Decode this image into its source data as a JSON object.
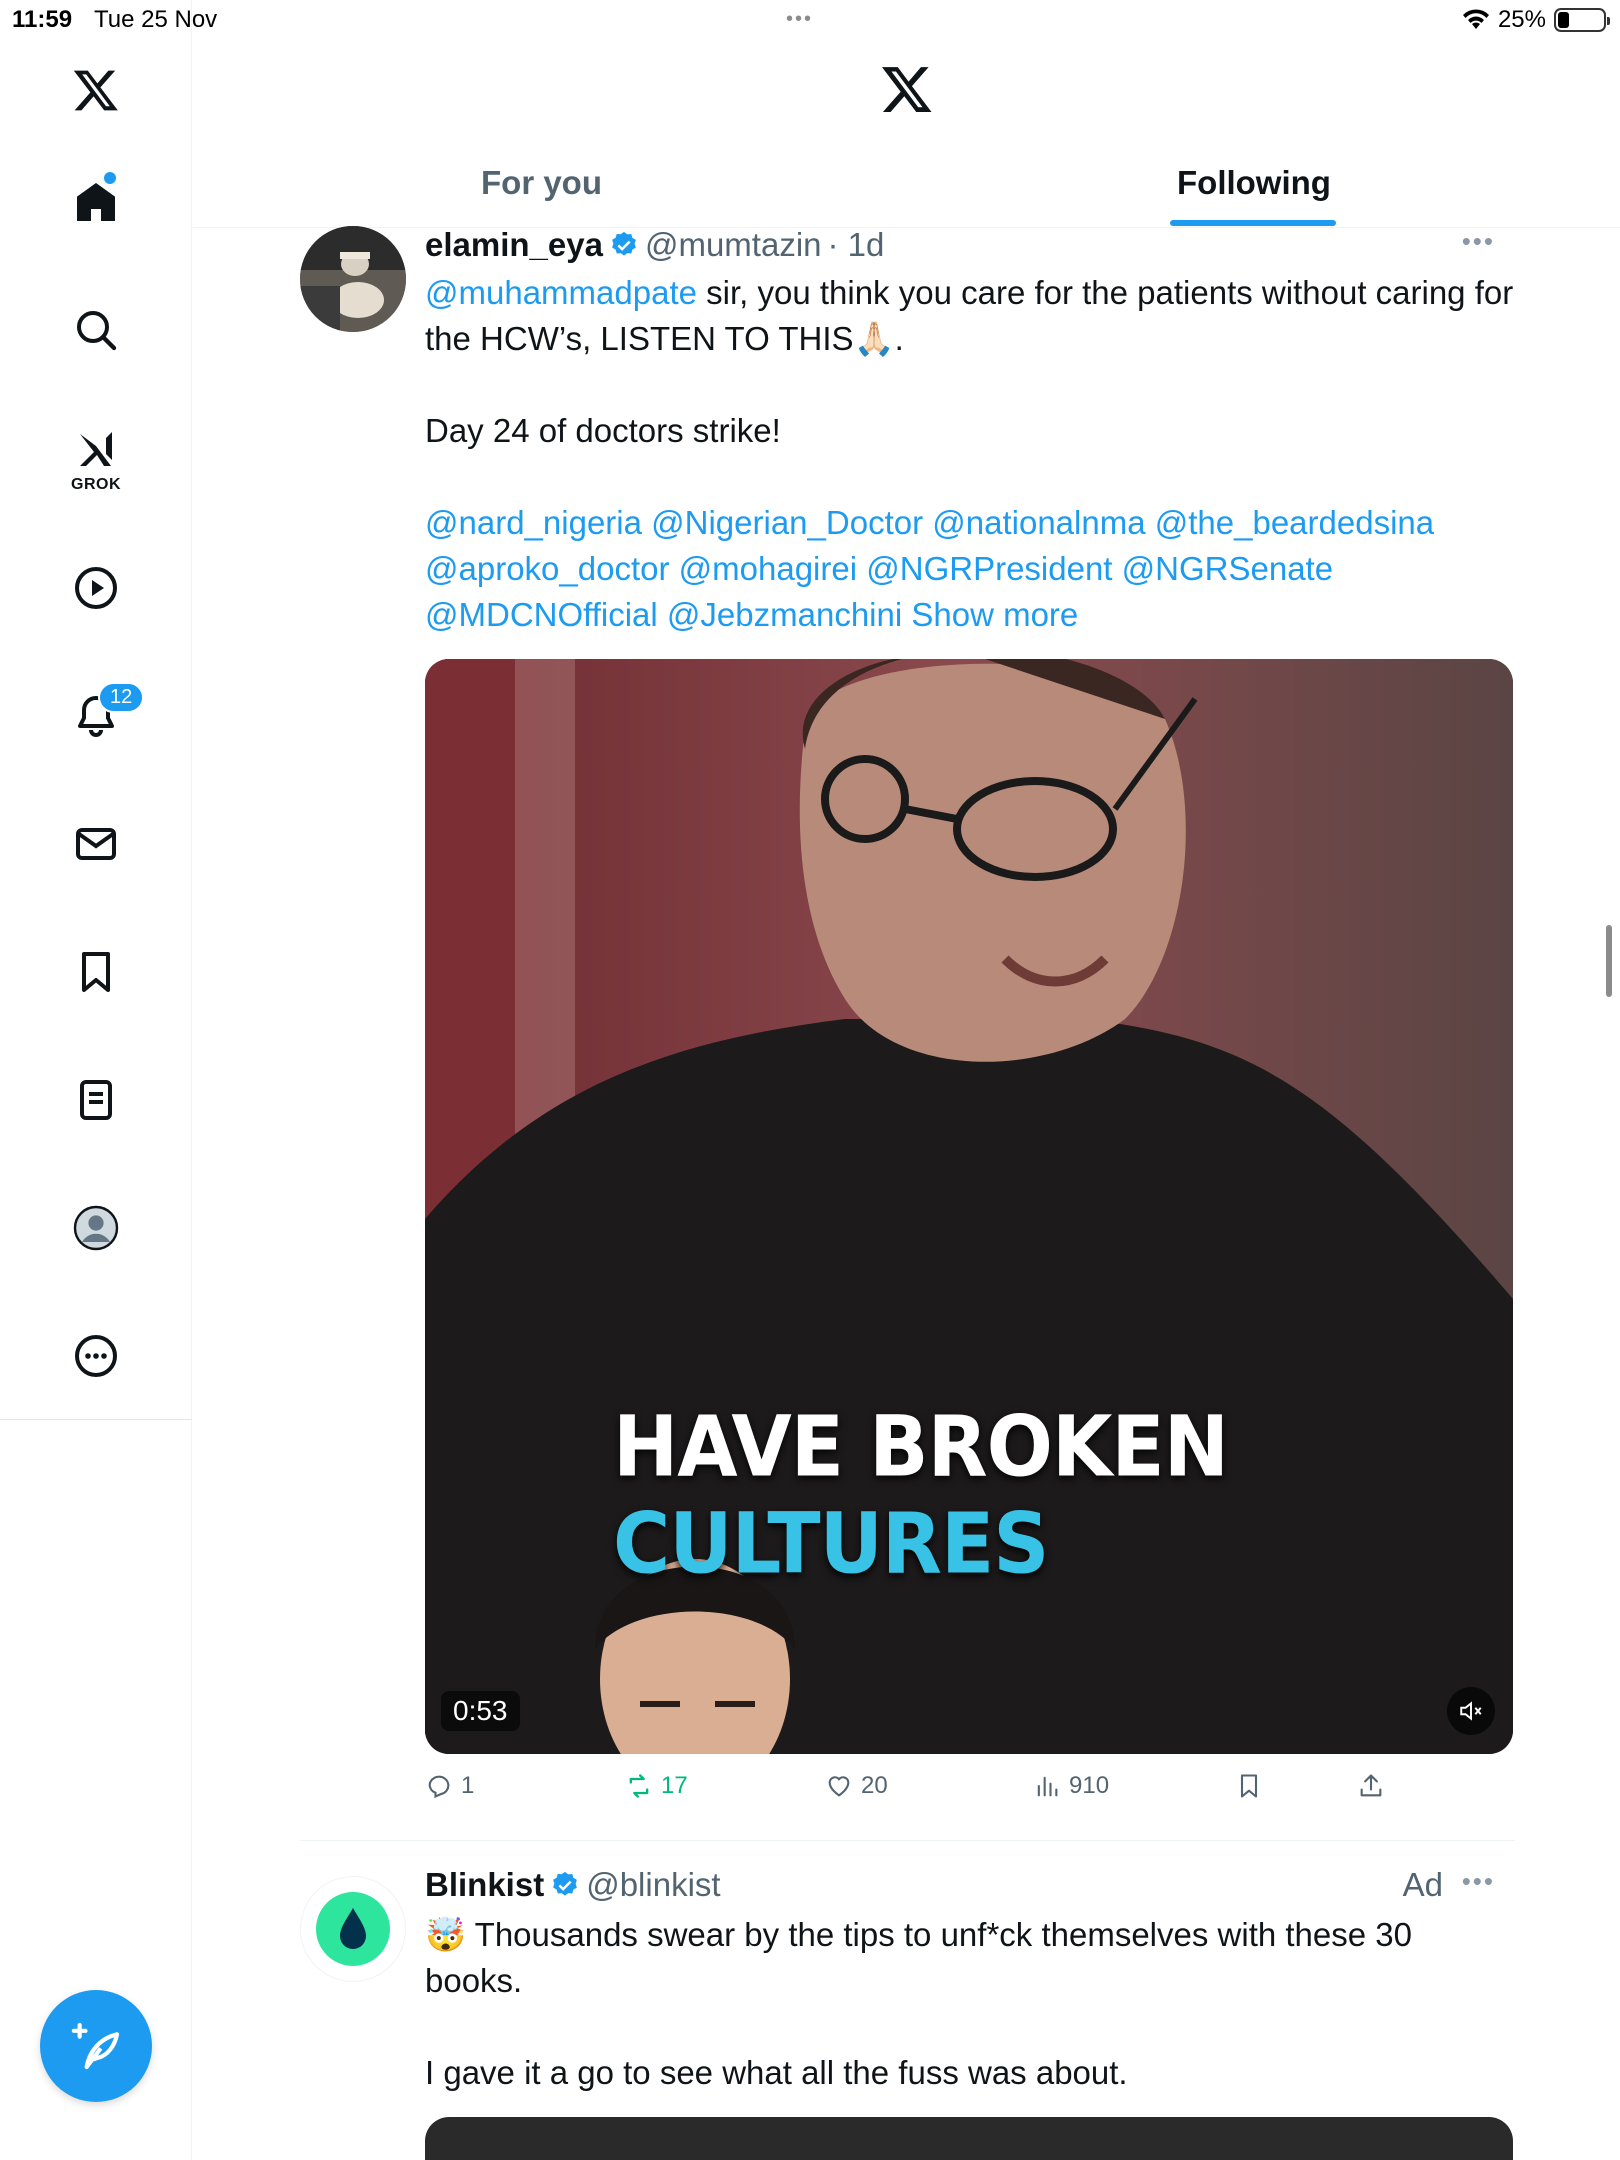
{
  "status_bar": {
    "time": "11:59",
    "date": "Tue 25 Nov",
    "battery": "25%"
  },
  "sidebar": {
    "grok_label": "GROK",
    "notifications_count": "12",
    "items": [
      "home",
      "explore",
      "grok",
      "videos",
      "notifications",
      "messages",
      "bookmarks",
      "lists",
      "profile",
      "more"
    ]
  },
  "header": {
    "tabs": [
      {
        "label": "For you"
      },
      {
        "label": "Following"
      }
    ],
    "active_tab": "Following"
  },
  "tweet": {
    "name": "elamin_eya",
    "handle": "@mumtazin",
    "time": "· 1d",
    "mention_first": "@muhammadpate",
    "text_line1": " sir, you think you care for the patients without caring for the HCW’s, LISTEN TO THIS🙏🏻.",
    "text_line2": "Day 24 of doctors strike!",
    "mentions": [
      "@nard_nigeria",
      "@Nigerian_Doctor",
      "@nationalnma",
      "@the_beardedsina",
      "@aproko_doctor",
      "@mohagirei",
      "@NGRPresident",
      "@NGRSenate",
      "@MDCNOfficial",
      "@Jebzmanchini"
    ],
    "show_more": "Show more",
    "video": {
      "caption_white": "HAVE BROKEN ",
      "caption_blue": "CULTURES",
      "duration": "0:53"
    },
    "stats": {
      "replies": "1",
      "reposts": "17",
      "likes": "20",
      "views": "910"
    }
  },
  "ad": {
    "name": "Blinkist",
    "handle": "@blinkist",
    "label": "Ad",
    "text_line1": "🤯 Thousands swear by the tips to unf*ck themselves with these 30 books.",
    "text_line2": "I gave it a go to see what all the fuss was about."
  },
  "colors": {
    "accent": "#1d9bf0",
    "repost": "#00ba7c",
    "secondary_text": "#536471"
  }
}
